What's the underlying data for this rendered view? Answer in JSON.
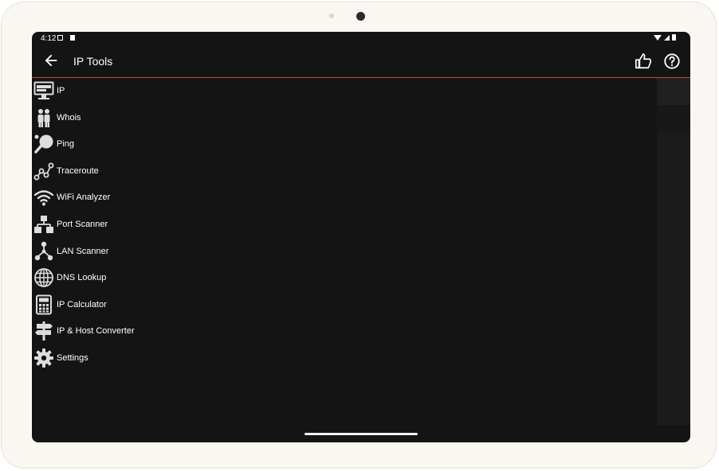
{
  "status_bar": {
    "time": "4:12"
  },
  "app_bar": {
    "title": "IP Tools"
  },
  "menu": [
    {
      "label": "IP",
      "icon": "monitor-icon"
    },
    {
      "label": "Whois",
      "icon": "people-icon"
    },
    {
      "label": "Ping",
      "icon": "ping-pong-icon"
    },
    {
      "label": "Traceroute",
      "icon": "route-icon"
    },
    {
      "label": "WiFi Analyzer",
      "icon": "wifi-icon"
    },
    {
      "label": "Port Scanner",
      "icon": "network-hierarchy-icon"
    },
    {
      "label": "LAN Scanner",
      "icon": "lan-nodes-icon"
    },
    {
      "label": "DNS Lookup",
      "icon": "globe-icon"
    },
    {
      "label": "IP Calculator",
      "icon": "calculator-icon"
    },
    {
      "label": "IP & Host Converter",
      "icon": "signpost-icon"
    },
    {
      "label": "Settings",
      "icon": "gear-icon"
    }
  ],
  "colors": {
    "accent_line": "#b0573a",
    "background": "#141414",
    "text": "#ffffff"
  }
}
